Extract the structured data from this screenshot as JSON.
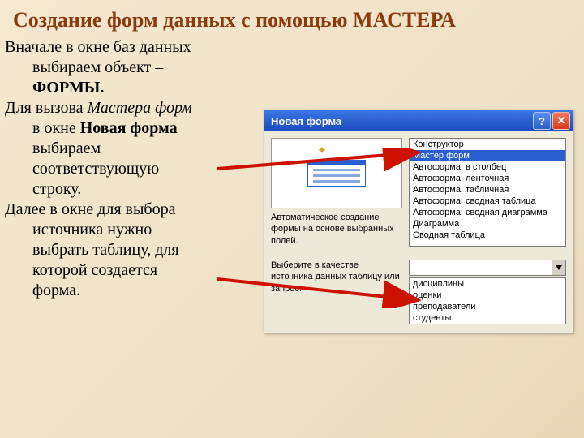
{
  "title": "Создание форм данных с помощью МАСТЕРА",
  "para1_lead": "Вначале в окне баз данных",
  "para1_rest_a": "выбираем объект –",
  "para1_rest_b": "ФОРМЫ.",
  "para2_lead": "Для вызова ",
  "para2_em": "Мастера форм",
  "para2_l2a": "в окне ",
  "para2_l2b": "Новая форма",
  "para2_l3": "выбираем",
  "para2_l4": "соответствующую",
  "para2_l5": "строку.",
  "para3_lead": "Далее в окне для выбора",
  "para3_l2": "источника нужно",
  "para3_l3": "выбрать таблицу, для",
  "para3_l4": "которой создается",
  "para3_l5": "форма.",
  "dialog": {
    "title": "Новая форма",
    "preview_caption": "Автоматическое создание формы на основе выбранных полей.",
    "options": [
      "Конструктор",
      "Мастер форм",
      "Автоформа: в столбец",
      "Автоформа: ленточная",
      "Автоформа: табличная",
      "Автоформа:  сводная таблица",
      "Автоформа:  сводная диаграмма",
      "Диаграмма",
      "Сводная таблица"
    ],
    "selected_index": 1,
    "source_label": "Выберите в качестве источника данных таблицу или запрос:",
    "tables": [
      "дисциплины",
      "оценки",
      "преподаватели",
      "студенты"
    ],
    "tables_selected_index": 2
  }
}
